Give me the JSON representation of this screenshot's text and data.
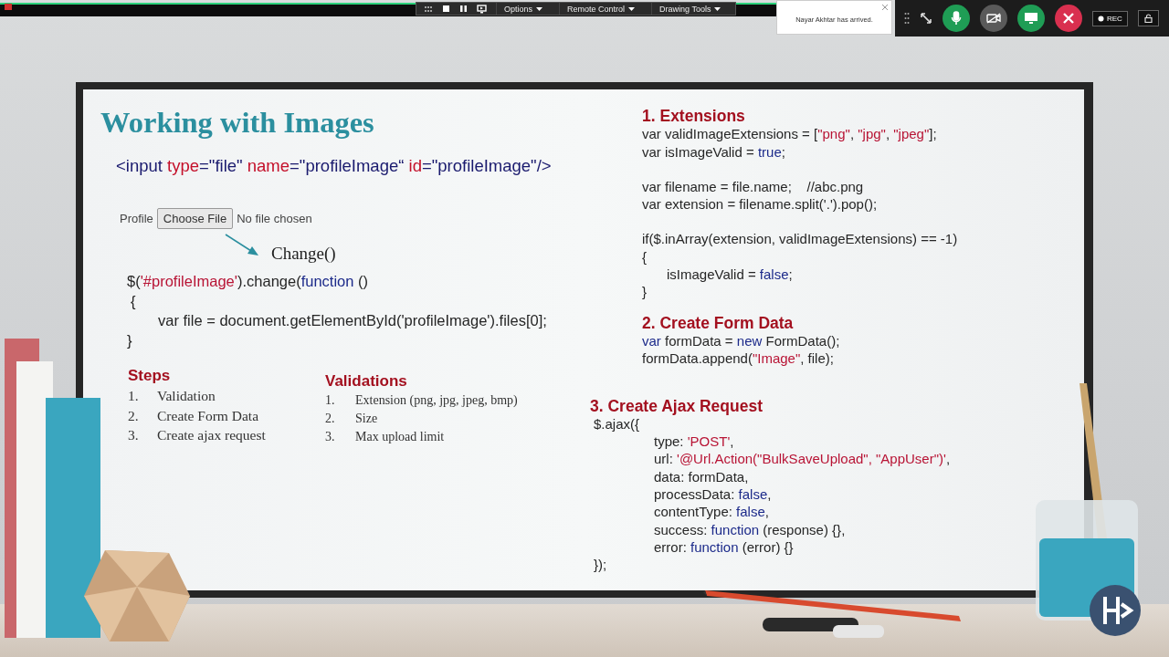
{
  "presenter_toolbar": {
    "menus": [
      {
        "label": "Options"
      },
      {
        "label": "Remote Control"
      },
      {
        "label": "Drawing Tools"
      }
    ]
  },
  "notification": {
    "message": "Nayar Akhtar has arrived."
  },
  "call_controls": {
    "mic_on": true,
    "camera_on": false,
    "record_label": "REC"
  },
  "slide": {
    "title": "Working with Images",
    "html_snippet": [
      {
        "text": "<input",
        "kind": "tag"
      },
      {
        "text": " type",
        "kind": "attribute"
      },
      {
        "text": "=\"file\"",
        "kind": "tag"
      },
      {
        "text": " name",
        "kind": "attribute"
      },
      {
        "text": "=\"profileImage“",
        "kind": "tag"
      },
      {
        "text": " id",
        "kind": "attribute"
      },
      {
        "text": "=\"profileImage\"/>",
        "kind": "tag"
      }
    ],
    "file_input": {
      "label": "Profile",
      "button": "Choose File",
      "status": "No file chosen"
    },
    "event_label": "Change()",
    "change_code": [
      {
        "tokens": [
          {
            "text": "$(",
            "kind": "plain"
          },
          {
            "text": "'#profileImage'",
            "kind": "literal"
          },
          {
            "text": ").change(",
            "kind": "plain"
          },
          {
            "text": "function",
            "kind": "keyword"
          },
          {
            "text": " ()",
            "kind": "plain"
          }
        ]
      },
      {
        "tokens": [
          {
            "text": "{",
            "kind": "plain"
          }
        ],
        "children": [
          {
            "tokens": [
              {
                "text": "var file = document.getElementById('profileImage').files[0];",
                "kind": "plain"
              }
            ]
          }
        ]
      },
      {
        "tokens": [
          {
            "text": "}",
            "kind": "plain"
          }
        ]
      }
    ],
    "steps": {
      "heading": "Steps",
      "items": [
        {
          "number": "1.",
          "text": "Validation"
        },
        {
          "number": "2.",
          "text": "Create Form Data"
        },
        {
          "number": "3.",
          "text": "Create ajax request"
        }
      ]
    },
    "validations": {
      "heading": "Validations",
      "items": [
        {
          "number": "1.",
          "text": "Extension (png, jpg, jpeg, bmp)"
        },
        {
          "number": "2.",
          "text": "Size"
        },
        {
          "number": "3.",
          "text": "Max upload limit"
        }
      ]
    },
    "sections": [
      {
        "heading": "1. Extensions",
        "blocks": [
          [
            {
              "tokens": [
                {
                  "text": "var validImageExtensions = [",
                  "kind": "plain"
                },
                {
                  "text": "\"png\"",
                  "kind": "literal"
                },
                {
                  "text": ", ",
                  "kind": "plain"
                },
                {
                  "text": "\"jpg\"",
                  "kind": "literal"
                },
                {
                  "text": ", ",
                  "kind": "plain"
                },
                {
                  "text": "\"jpeg\"",
                  "kind": "literal"
                },
                {
                  "text": "];",
                  "kind": "plain"
                }
              ]
            },
            {
              "tokens": [
                {
                  "text": "var isImageValid = ",
                  "kind": "plain"
                },
                {
                  "text": "true",
                  "kind": "keyword"
                },
                {
                  "text": ";",
                  "kind": "plain"
                }
              ]
            }
          ],
          [
            {
              "tokens": [
                {
                  "text": "var filename = file.name;    //abc.png",
                  "kind": "plain"
                }
              ]
            },
            {
              "tokens": [
                {
                  "text": "var extension = filename.split('.').pop();",
                  "kind": "plain"
                }
              ]
            }
          ],
          [
            {
              "tokens": [
                {
                  "text": "if($.inArray(extension, validImageExtensions) == -1)",
                  "kind": "plain"
                }
              ]
            },
            {
              "tokens": [
                {
                  "text": "{",
                  "kind": "plain"
                }
              ],
              "children": [
                {
                  "tokens": [
                    {
                      "text": "isImageValid = ",
                      "kind": "plain"
                    },
                    {
                      "text": "false",
                      "kind": "keyword"
                    },
                    {
                      "text": ";",
                      "kind": "plain"
                    }
                  ]
                }
              ]
            },
            {
              "tokens": [
                {
                  "text": "}",
                  "kind": "plain"
                }
              ]
            }
          ]
        ]
      },
      {
        "heading": "2. Create Form Data",
        "blocks": [
          [
            {
              "tokens": [
                {
                  "text": "var",
                  "kind": "keyword"
                },
                {
                  "text": " formData = ",
                  "kind": "plain"
                },
                {
                  "text": "new",
                  "kind": "keyword"
                },
                {
                  "text": " FormData();",
                  "kind": "plain"
                }
              ]
            },
            {
              "tokens": [
                {
                  "text": "formData.append(",
                  "kind": "plain"
                },
                {
                  "text": "\"Image\"",
                  "kind": "literal"
                },
                {
                  "text": ", file);",
                  "kind": "plain"
                }
              ]
            }
          ]
        ]
      },
      {
        "heading": "3. Create Ajax Request",
        "blocks": [
          [
            {
              "tokens": [
                {
                  "text": "$.ajax({",
                  "kind": "plain"
                }
              ],
              "children": [
                {
                  "tokens": [
                    {
                      "text": "type: ",
                      "kind": "plain"
                    },
                    {
                      "text": "'POST'",
                      "kind": "literal"
                    },
                    {
                      "text": ",",
                      "kind": "plain"
                    }
                  ]
                },
                {
                  "tokens": [
                    {
                      "text": "url: ",
                      "kind": "plain"
                    },
                    {
                      "text": "'@Url.Action(\"BulkSaveUpload\", \"AppUser\")'",
                      "kind": "literal"
                    },
                    {
                      "text": ",",
                      "kind": "plain"
                    }
                  ]
                },
                {
                  "tokens": [
                    {
                      "text": "data: formData,",
                      "kind": "plain"
                    }
                  ]
                },
                {
                  "tokens": [
                    {
                      "text": "processData: ",
                      "kind": "plain"
                    },
                    {
                      "text": "false",
                      "kind": "keyword"
                    },
                    {
                      "text": ",",
                      "kind": "plain"
                    }
                  ]
                },
                {
                  "tokens": [
                    {
                      "text": "contentType: ",
                      "kind": "plain"
                    },
                    {
                      "text": "false",
                      "kind": "keyword"
                    },
                    {
                      "text": ",",
                      "kind": "plain"
                    }
                  ]
                },
                {
                  "tokens": [
                    {
                      "text": "success: ",
                      "kind": "plain"
                    },
                    {
                      "text": "function",
                      "kind": "keyword"
                    },
                    {
                      "text": " (response) {},",
                      "kind": "plain"
                    }
                  ]
                },
                {
                  "tokens": [
                    {
                      "text": "error: ",
                      "kind": "plain"
                    },
                    {
                      "text": "function",
                      "kind": "keyword"
                    },
                    {
                      "text": " (error) {}",
                      "kind": "plain"
                    }
                  ]
                }
              ]
            },
            {
              "tokens": [
                {
                  "text": "});",
                  "kind": "plain"
                }
              ]
            }
          ]
        ]
      }
    ]
  }
}
